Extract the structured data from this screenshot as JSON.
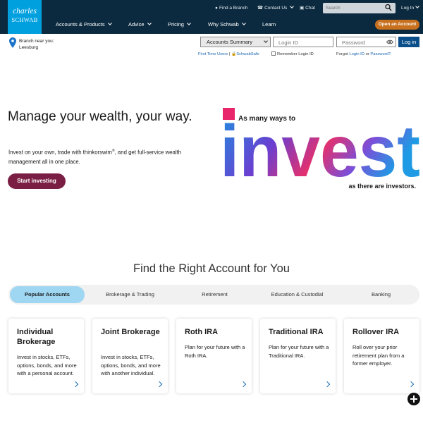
{
  "logo": {
    "line1": "charles",
    "line2": "SCHWAB"
  },
  "utility": {
    "find_branch": "Find a Branch",
    "contact_us": "Contact Us",
    "chat": "Chat",
    "search_placeholder": "Search",
    "login": "Log In"
  },
  "nav": {
    "items": [
      {
        "label": "Accounts & Products"
      },
      {
        "label": "Advice"
      },
      {
        "label": "Pricing"
      },
      {
        "label": "Why Schwab"
      },
      {
        "label": "Learn"
      }
    ],
    "open_account": "Open an Account"
  },
  "subbar": {
    "branch_line1": "Branch near you:",
    "branch_line2": "Leesburg",
    "accounts_select": "Accounts Summary",
    "login_id_placeholder": "Login ID",
    "password_placeholder": "Password",
    "login_button": "Log in",
    "first_time": "First Time Users",
    "sep": "|",
    "schwabsafe": "SchwabSafe",
    "remember": "Remember Login ID",
    "forgot": "Forgot",
    "forgot_login": "Login ID",
    "or": "or",
    "forgot_password": "Password?"
  },
  "hero": {
    "title": "Manage your wealth, your way.",
    "text_before": "Invest on your own, trade with thinkorswim",
    "reg": "®",
    "text_after": ", and get full-service wealth management all in one place.",
    "cta": "Start investing",
    "art_top": "As many ways to",
    "art_word": "invest",
    "art_bottom": "as there are investors."
  },
  "accounts": {
    "title": "Find the Right Account for You",
    "tabs": [
      {
        "label": "Popular Accounts"
      },
      {
        "label": "Brokerage & Trading"
      },
      {
        "label": "Retirement"
      },
      {
        "label": "Education & Custodial"
      },
      {
        "label": "Banking"
      }
    ],
    "cards": [
      {
        "title": "Individual Brokerage",
        "desc": "Invest in stocks, ETFs, options, bonds, and more with a personal account."
      },
      {
        "title": "Joint Brokerage",
        "desc": "Invest in stocks, ETFs, options, bonds, and more with another individual."
      },
      {
        "title": "Roth IRA",
        "desc": "Plan for your future with a Roth IRA."
      },
      {
        "title": "Traditional IRA",
        "desc": "Plan for your future with a Traditional IRA."
      },
      {
        "title": "Rollover IRA",
        "desc": "Roll over your prior retirement plan from a former employer."
      }
    ]
  },
  "colors": {
    "header_bg": "#0b2a3f",
    "logo_bg": "#00a0df",
    "open_account": "#c8701e",
    "start_investing": "#7a1f43",
    "active_tab": "#9fd6f2",
    "login_button": "#0b4f8a"
  },
  "icons": [
    "location-pin-icon",
    "phone-icon",
    "chat-icon",
    "search-icon",
    "map-pin-icon",
    "lock-icon",
    "eye-icon",
    "chevron-right-icon",
    "plus-icon"
  ]
}
